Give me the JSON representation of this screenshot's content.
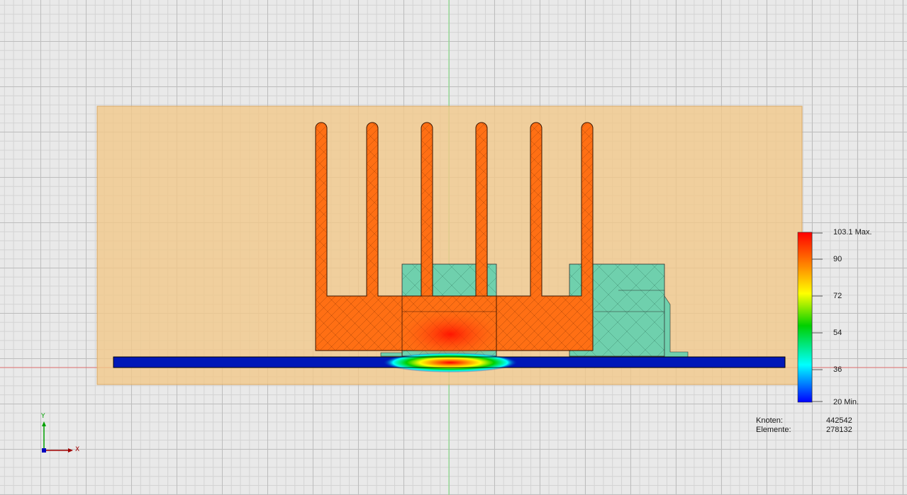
{
  "legend": {
    "max_label": "103.1 Max.",
    "min_label": "20 Min.",
    "ticks": [
      "90",
      "72",
      "54",
      "36"
    ],
    "colors": [
      "#ff0000",
      "#ff8000",
      "#ffff00",
      "#00e000",
      "#00ffff",
      "#0000ff"
    ]
  },
  "stats": {
    "nodes_label": "Knoten:",
    "nodes_value": "442542",
    "elements_label": "Elemente:",
    "elements_value": "278132"
  },
  "axes": {
    "y_label": "Y",
    "x_label": "X"
  },
  "model": {
    "heatsink_color": "#ff6f14",
    "component_color": "#6fd0ad",
    "pcb_color": "#0018b8",
    "domain_color": "#f1c88a"
  }
}
